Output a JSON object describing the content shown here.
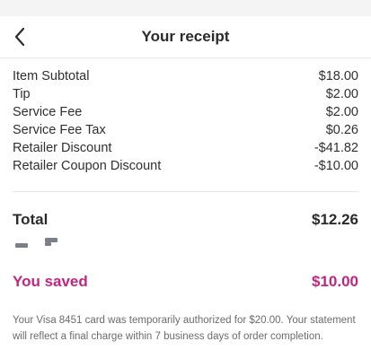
{
  "header": {
    "title": "Your receipt",
    "back_icon": "chevron-left-icon"
  },
  "line_items": [
    {
      "label": "Item Subtotal",
      "value": "$18.00"
    },
    {
      "label": "Tip",
      "value": "$2.00"
    },
    {
      "label": "Service Fee",
      "value": "$2.00"
    },
    {
      "label": "Service Fee Tax",
      "value": "$0.26"
    },
    {
      "label": "Retailer Discount",
      "value": "-$41.82"
    },
    {
      "label": "Retailer Coupon Discount",
      "value": "-$10.00"
    }
  ],
  "total": {
    "label": "Total",
    "value": "$12.26"
  },
  "saved": {
    "label": "You saved",
    "value": "$10.00"
  },
  "footnote": "Your Visa 8451 card was temporarily authorized for $20.00. Your statement will reflect a final charge within 7 business days of order completion.",
  "colors": {
    "saved_accent": "#c0267e",
    "text_primary": "#2b2b2b",
    "text_muted": "#6b6b6b"
  }
}
